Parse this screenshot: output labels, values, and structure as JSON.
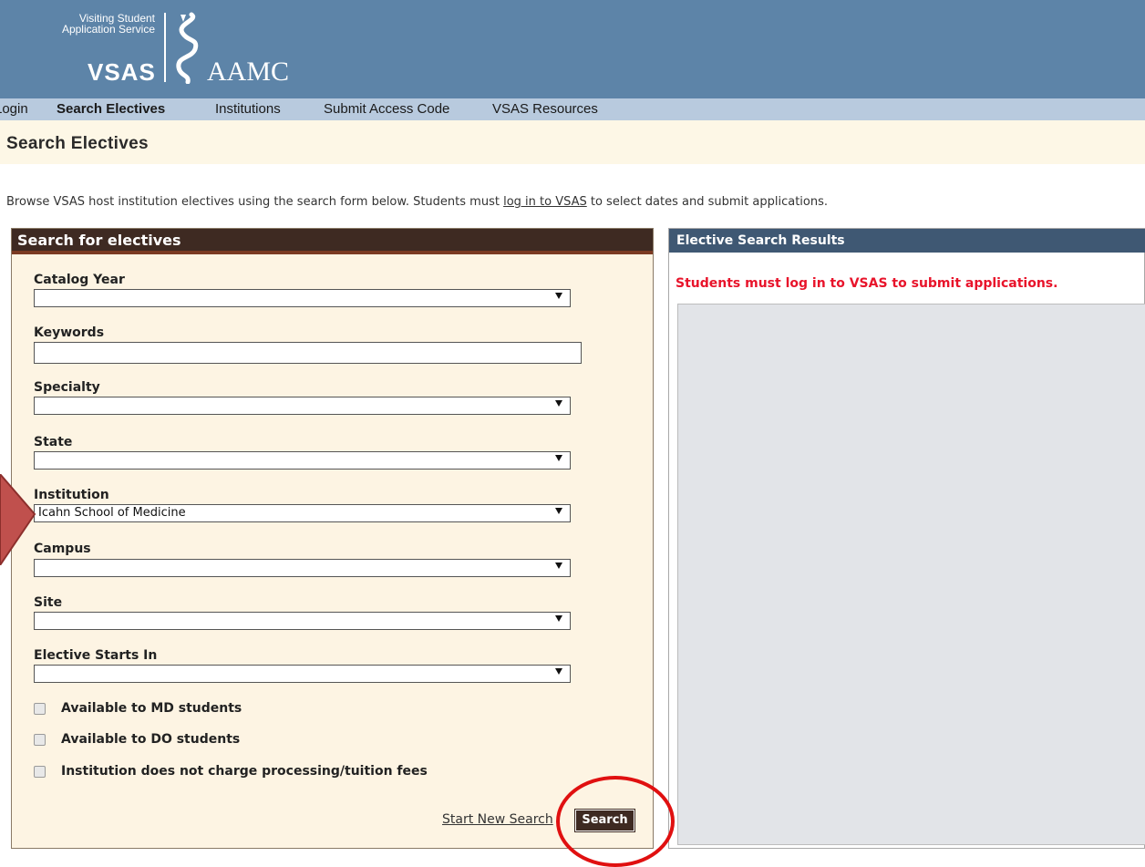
{
  "header": {
    "logo_line1": "Visiting Student",
    "logo_line2": "Application Service",
    "logo_vsas": "VSAS",
    "logo_aamc": "AAMC"
  },
  "nav": {
    "items": [
      "Login",
      "Search Electives",
      "Institutions",
      "Submit Access Code",
      "VSAS Resources"
    ],
    "active": "Search Electives"
  },
  "page_title": "Search Electives",
  "intro": {
    "before": "Browse VSAS host institution electives using the search form below. Students must ",
    "link": "log in to VSAS",
    "after": " to select dates and submit applications."
  },
  "search_panel": {
    "title": "Search for electives",
    "fields": {
      "catalog_year": {
        "label": "Catalog Year",
        "value": ""
      },
      "keywords": {
        "label": "Keywords",
        "value": ""
      },
      "specialty": {
        "label": "Specialty",
        "value": ""
      },
      "state": {
        "label": "State",
        "value": ""
      },
      "institution": {
        "label": "Institution",
        "value": "Icahn School of Medicine"
      },
      "campus": {
        "label": "Campus",
        "value": ""
      },
      "site": {
        "label": "Site",
        "value": ""
      },
      "elective_starts_in": {
        "label": "Elective Starts In",
        "value": ""
      }
    },
    "checkboxes": [
      {
        "label": "Available to MD students",
        "checked": false
      },
      {
        "label": "Available to DO students",
        "checked": false
      },
      {
        "label": "Institution does not charge processing/tuition fees",
        "checked": false
      }
    ],
    "start_new_link": "Start New Search",
    "search_button": "Search"
  },
  "results_panel": {
    "title": "Elective Search Results",
    "notice": "Students must log in to VSAS to submit applications.",
    "notice_color": "#e8142b"
  },
  "colors": {
    "banner": "#5d84a8",
    "nav": "#b8cade",
    "search_header": "#3e2a22",
    "results_header": "#3f5873",
    "annotation": "#e01010"
  }
}
